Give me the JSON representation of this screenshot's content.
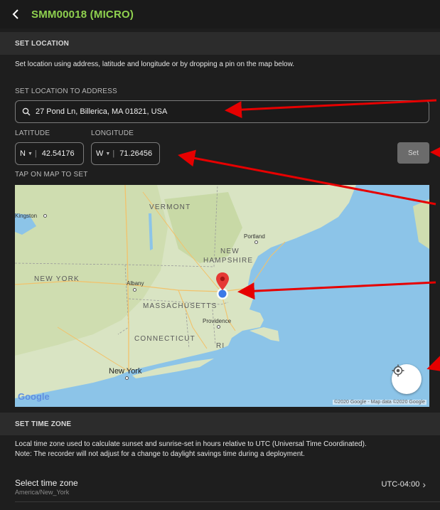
{
  "header": {
    "title": "SMM00018 (MICRO)"
  },
  "set_location": {
    "section_title": "SET LOCATION",
    "description": "Set location using address, latitude and longitude or by dropping a pin on the map below.",
    "address_label": "SET LOCATION TO ADDRESS",
    "address_value": "27 Pond Ln, Billerica, MA 01821, USA",
    "latitude_label": "LATITUDE",
    "longitude_label": "LONGITUDE",
    "lat_hemisphere": "N",
    "lat_value": "42.54176",
    "lon_hemisphere": "W",
    "lon_value": "71.26456",
    "set_button": "Set",
    "map_label": "TAP ON MAP TO SET"
  },
  "map": {
    "labels": {
      "vermont": "VERMONT",
      "new_hampshire_1": "NEW",
      "new_hampshire_2": "HAMPSHIRE",
      "new_york_state": "NEW YORK",
      "massachusetts": "MASSACHUSETTS",
      "connecticut": "CONNECTICUT",
      "ri": "RI"
    },
    "cities": {
      "kingston": "Kingston",
      "portland": "Portland",
      "albany": "Albany",
      "providence": "Providence",
      "new_york": "New York"
    },
    "google_logo": "Google",
    "copyright": "©2020 Google - Map data ©2020 Google"
  },
  "time_zone": {
    "section_title": "SET TIME ZONE",
    "description_1": "Local time zone used to calculate sunset and sunrise-set in hours relative to UTC (Universal Time Coordinated).",
    "description_2": "Note: The recorder will not adjust for a change to daylight savings time during a deployment.",
    "select_label": "Select time zone",
    "selected_zone": "America/New_York",
    "offset": "UTC-04:00"
  },
  "colors": {
    "accent": "#8fd14f",
    "annotation_arrow": "#e60000",
    "pin": "#e53935"
  }
}
